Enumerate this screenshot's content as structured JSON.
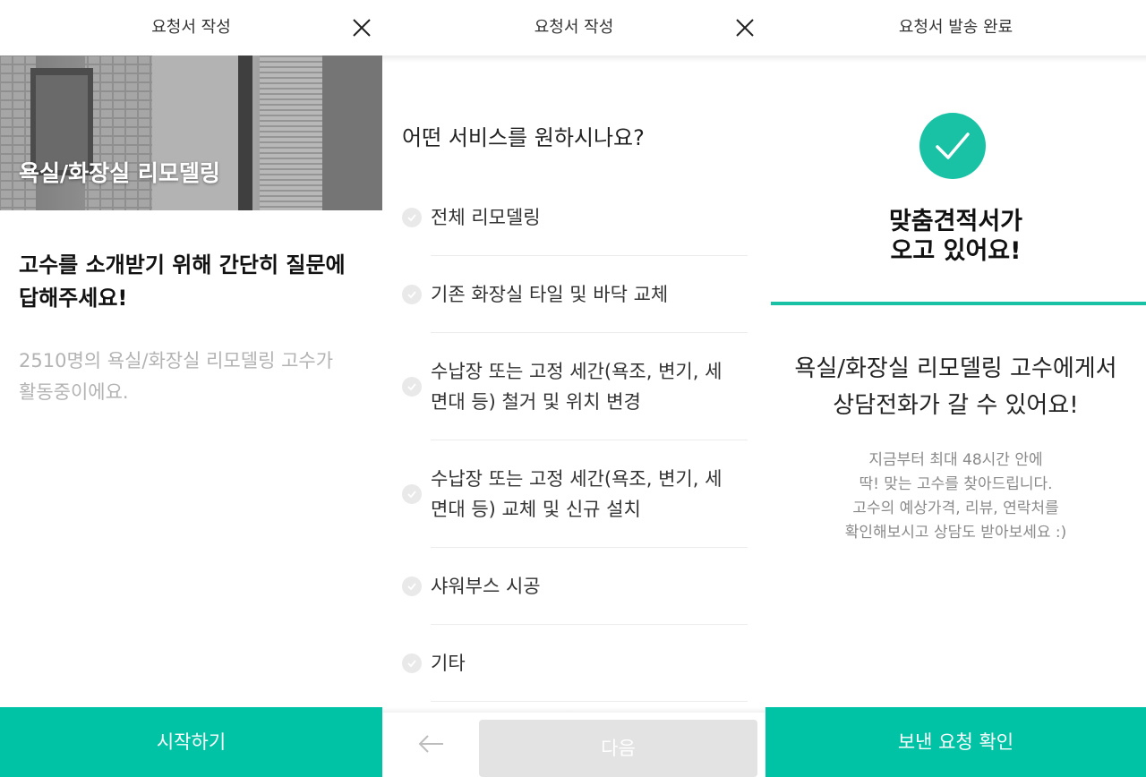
{
  "colors": {
    "accent": "#00c3a5",
    "disabled": "#e3e3e3",
    "check_bg": "#e9e9e9"
  },
  "panel1": {
    "header_title": "요청서 작성",
    "close_icon": "close-icon",
    "hero_title": "욕실/화장실 리모델링",
    "intro_title_line1": "고수를 소개받기 위해 간단히 질문에",
    "intro_title_line2": "답해주세요!",
    "intro_sub_line1": "2510명의 욕실/화장실 리모델링 고수가",
    "intro_sub_line2": "활동중이에요.",
    "start_button": "시작하기"
  },
  "panel2": {
    "header_title": "요청서 작성",
    "close_icon": "close-icon",
    "question": "어떤 서비스를 원하시나요?",
    "options": [
      {
        "line1": "전체 리모델링",
        "line2": ""
      },
      {
        "line1": "기존 화장실 타일 및 바닥 교체",
        "line2": ""
      },
      {
        "line1": "수납장 또는 고정 세간(욕조, 변기, 세",
        "line2": "면대 등) 철거 및 위치 변경"
      },
      {
        "line1": "수납장 또는 고정 세간(욕조, 변기, 세",
        "line2": "면대 등) 교체 및 신규 설치"
      },
      {
        "line1": "샤워부스 시공",
        "line2": ""
      },
      {
        "line1": "기타",
        "line2": ""
      }
    ],
    "back_icon": "arrow-left-icon",
    "next_button": "다음"
  },
  "panel3": {
    "header_title": "요청서 발송 완료",
    "check_icon": "checkmark-icon",
    "done_line1": "맞춤견적서가",
    "done_line2": "오고 있어요!",
    "msg_line1": "욕실/화장실 리모델링 고수에게서",
    "msg_line2": "상담전화가 갈 수 있어요!",
    "desc_line1": "지금부터 최대 48시간 안에",
    "desc_line2": "딱! 맞는 고수를 찾아드립니다.",
    "desc_line3": "고수의 예상가격, 리뷰, 연락처를",
    "desc_line4": "확인해보시고 상담도 받아보세요 :)",
    "confirm_button": "보낸 요청 확인"
  }
}
